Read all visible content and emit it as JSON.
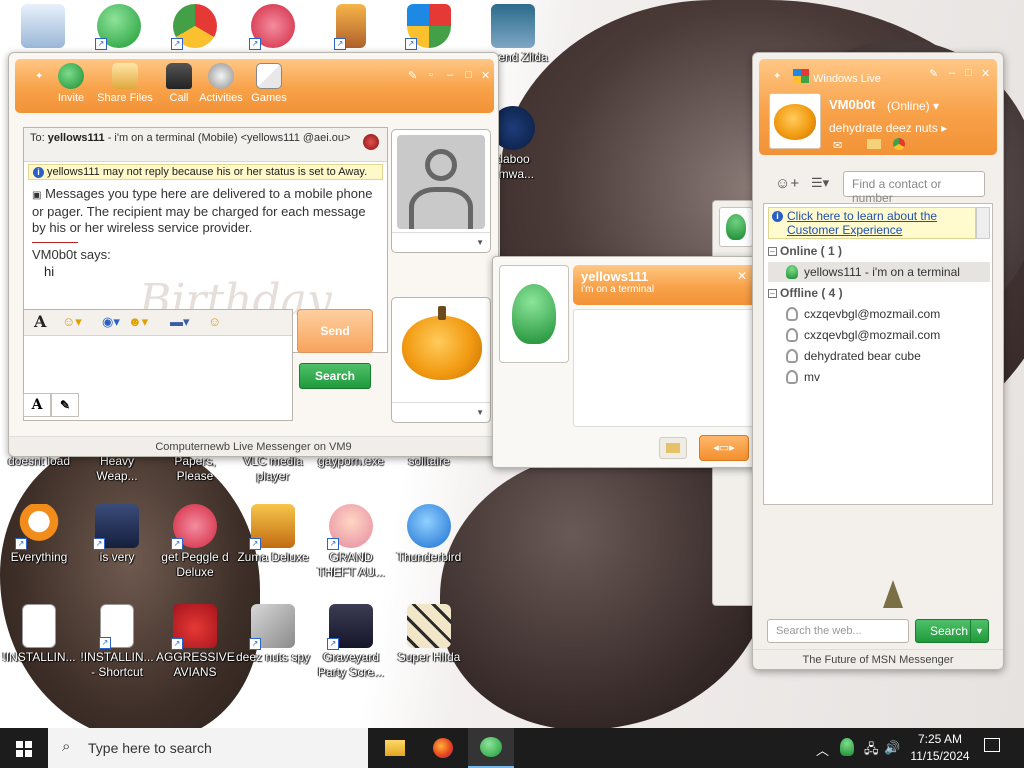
{
  "desktop_icons": [
    {
      "label": "",
      "icon": "recycle-bin-icon"
    },
    {
      "label": "",
      "icon": "messenger-icon"
    },
    {
      "label": "",
      "icon": "chrome-icon"
    },
    {
      "label": "",
      "icon": "peggle-icon"
    },
    {
      "label": "",
      "icon": "door-icon"
    },
    {
      "label": "",
      "icon": "shield-icon"
    },
    {
      "label": "Legend Zilda",
      "icon": "zelda-icon"
    },
    {
      "label": "daboo omwa...",
      "icon": "shma-icon"
    },
    {
      "label": "doesnt load",
      "icon": "app-icon"
    },
    {
      "label": "Heavy Weap...",
      "icon": "app-icon"
    },
    {
      "label": "Papers, Please",
      "icon": "app-icon"
    },
    {
      "label": "VLC media player",
      "icon": "vlc-icon"
    },
    {
      "label": "gayporn.exe",
      "icon": "app-icon"
    },
    {
      "label": "solitaire",
      "icon": "cards-icon"
    },
    {
      "label": "Everything",
      "icon": "search-magnifier-icon"
    },
    {
      "label": "is very",
      "icon": "mask-icon"
    },
    {
      "label": "get Peggle d Deluxe",
      "icon": "peggle-icon"
    },
    {
      "label": "Zuma Deluxe",
      "icon": "zuma-icon"
    },
    {
      "label": "GRAND THEFT AU...",
      "icon": "anime-girl-icon"
    },
    {
      "label": "Thunderbird",
      "icon": "thunderbird-icon"
    },
    {
      "label": "!INSTALLIN...",
      "icon": "document-icon"
    },
    {
      "label": "!INSTALLIN... - Shortcut",
      "icon": "document-icon"
    },
    {
      "label": "AGGRESSIVE AVIANS",
      "icon": "angry-bird-icon"
    },
    {
      "label": "deez nuts spy",
      "icon": "copy-icon"
    },
    {
      "label": "Graveyard Party Scre...",
      "icon": "graveyard-icon"
    },
    {
      "label": "Super Hilda",
      "icon": "pixel-art-icon"
    }
  ],
  "chat": {
    "toolbar": {
      "invite": "Invite",
      "share_files": "Share Files",
      "call": "Call",
      "activities": "Activities",
      "games": "Games"
    },
    "to_label": "To:",
    "to_name": "yellows111",
    "to_detail": "- i'm on a terminal (Mobile) <yellows111 @aei.ou>",
    "away_note": "yellows111 may not reply because his or her status is set to Away.",
    "mobile_notice": "Messages you type here are delivered to a mobile phone or pager. The recipient may be charged for each message by his or her wireless service provider.",
    "sender_says": "VM0b0t says:",
    "message": "hi",
    "watermark": "Birthday",
    "send": "Send",
    "search": "Search",
    "footer": "Computernewb Live Messenger on VM9"
  },
  "card": {
    "name": "yellows111",
    "status": "i'm on a terminal"
  },
  "contact_list": {
    "title": "Windows Live",
    "my_name": "VM0b0t",
    "my_status": "(Online)",
    "my_psm": "dehydrate deez nuts",
    "find_placeholder": "Find a contact or number",
    "cx_link": "Click here to learn about the Customer Experience",
    "online_group": "Online ( 1 )",
    "online_contacts": [
      "yellows111 - i'm on a terminal"
    ],
    "offline_group": "Offline ( 4 )",
    "offline_contacts": [
      "cxzqevbgl@mozmail.com",
      "cxzqevbgl@mozmail.com",
      "dehydrated bear cube",
      "mv"
    ],
    "web_search_placeholder": "Search the web...",
    "search": "Search",
    "footer": "The Future of MSN Messenger"
  },
  "taskbar": {
    "search_placeholder": "Type here to search",
    "time": "7:25 AM",
    "date": "11/15/2024"
  },
  "colors": {
    "accent_orange": "#f7a04a",
    "accent_green": "#1f9a3b",
    "taskbar": "#1c1c1c"
  }
}
